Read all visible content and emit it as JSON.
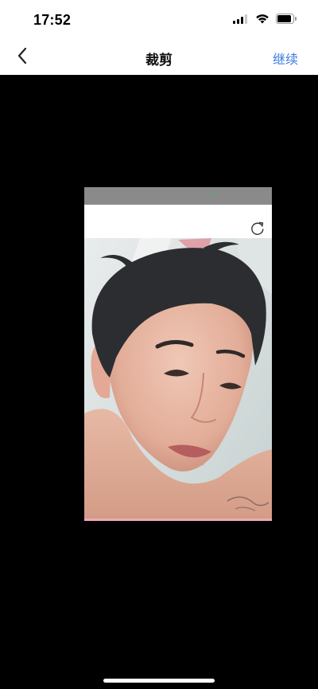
{
  "status_bar": {
    "time": "17:52",
    "icons": [
      "signal-icon",
      "wifi-icon",
      "battery-icon"
    ]
  },
  "nav": {
    "back_icon": "chevron-left-icon",
    "title": "裁剪",
    "continue_label": "继续",
    "accent_color": "#3c7be0"
  },
  "crop": {
    "background_color": "#000000",
    "embedded_toolbar_icon": "rotate-icon",
    "photo_subject": "portrait-photo"
  }
}
